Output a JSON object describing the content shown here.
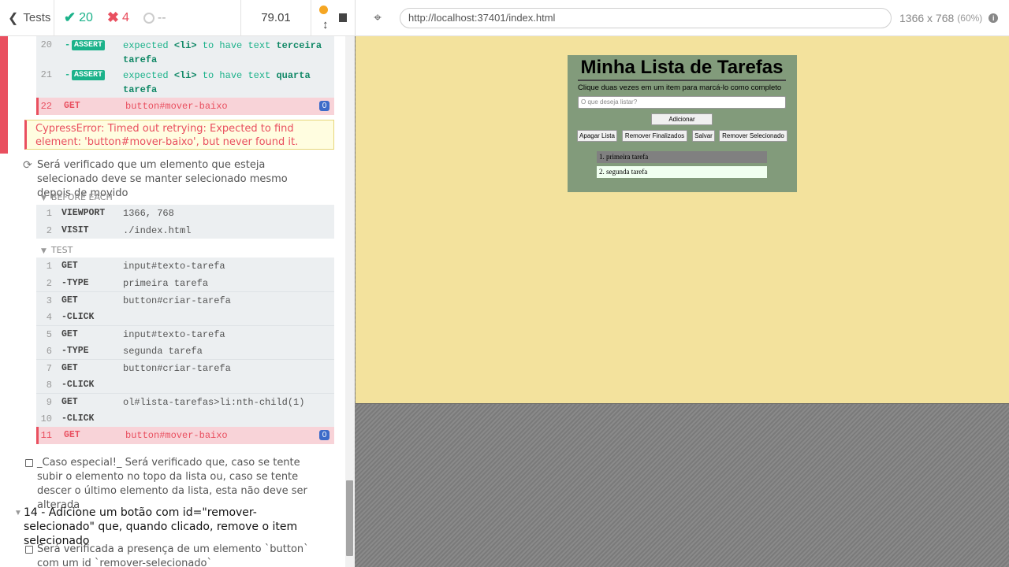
{
  "reporter_header": {
    "tests_label": "Tests",
    "passed": "20",
    "failed": "4",
    "pending": "--",
    "duration": "79.01"
  },
  "aut_header": {
    "url": "http://localhost:37401/index.html",
    "viewport": "1366 x 768",
    "scale": "(60%)"
  },
  "prev_test": {
    "asserts": [
      {
        "num": "20",
        "tag": "ASSERT",
        "pre": "expected",
        "el": "<li>",
        "mid": "to have text",
        "val": "terceira tarefa"
      },
      {
        "num": "21",
        "tag": "ASSERT",
        "pre": "expected",
        "el": "<li>",
        "mid": "to have text",
        "val": "quarta tarefa"
      }
    ],
    "failed_cmd": {
      "num": "22",
      "name": "GET",
      "msg": "button#mover-baixo",
      "badge": "0"
    },
    "error": "CypressError: Timed out retrying: Expected to find element: 'button#mover-baixo', but never found it."
  },
  "current_test": {
    "title": "Será verificado que um elemento que esteja selecionado deve se manter selecionado mesmo depois de movido",
    "before_each_label": "BEFORE EACH",
    "before_each": [
      {
        "num": "1",
        "name": "VIEWPORT",
        "msg": "1366, 768"
      },
      {
        "num": "2",
        "name": "VISIT",
        "msg": "./index.html"
      }
    ],
    "test_label": "TEST",
    "commands": [
      {
        "num": "1",
        "name": "GET",
        "msg": "input#texto-tarefa"
      },
      {
        "num": "2",
        "name": "-TYPE",
        "msg": "primeira tarefa"
      },
      {
        "num": "3",
        "name": "GET",
        "msg": "button#criar-tarefa"
      },
      {
        "num": "4",
        "name": "-CLICK",
        "msg": ""
      },
      {
        "num": "5",
        "name": "GET",
        "msg": "input#texto-tarefa"
      },
      {
        "num": "6",
        "name": "-TYPE",
        "msg": "segunda tarefa"
      },
      {
        "num": "7",
        "name": "GET",
        "msg": "button#criar-tarefa"
      },
      {
        "num": "8",
        "name": "-CLICK",
        "msg": ""
      },
      {
        "num": "9",
        "name": "GET",
        "msg": "ol#lista-tarefas>li:nth-child(1)"
      },
      {
        "num": "10",
        "name": "-CLICK",
        "msg": ""
      }
    ],
    "failed_cmd": {
      "num": "11",
      "name": "GET",
      "msg": "button#mover-baixo",
      "badge": "0"
    }
  },
  "pending_test": "_Caso especial!_ Será verificado que, caso se tente subir o elemento no topo da lista ou, caso se tente descer o último elemento da lista, esta não deve ser alterada",
  "suite_14": "14 - Adicione um botão com id=\"remover-selecionado\" que, quando clicado, remove o item selecionado",
  "suite_14_test": "Será verificada a presença de um elemento `button` com um id `remover-selecionado`",
  "app": {
    "title": "Minha Lista de Tarefas",
    "subtitle": "Clique duas vezes em um item para marcá-lo como completo",
    "input_placeholder": "O que deseja listar?",
    "add_button": "Adicionar",
    "buttons": [
      "Apagar Lista",
      "Remover Finalizados",
      "Salvar",
      "Remover Selecionado"
    ],
    "tasks": [
      "1. primeira tarefa",
      "2. segunda tarefa"
    ]
  }
}
